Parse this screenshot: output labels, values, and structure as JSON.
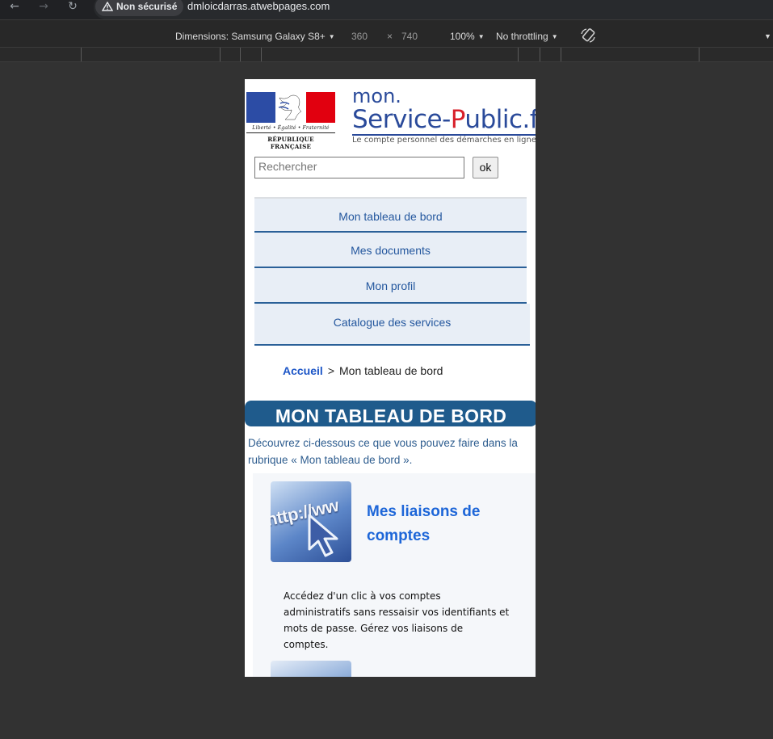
{
  "browser": {
    "security_label": "Non sécurisé",
    "url": "dmloicdarras.atwebpages.com",
    "icons": [
      "back-icon",
      "forward-icon",
      "reload-icon",
      "warning-icon"
    ]
  },
  "devtools": {
    "dimensions_label": "Dimensions: Samsung Galaxy S8+",
    "width": "360",
    "times": "×",
    "height": "740",
    "zoom": "100%",
    "throttling": "No throttling"
  },
  "header": {
    "motto": "Liberté • Égalité • Fraternité",
    "republic": "RÉPUBLIQUE FRANÇAISE",
    "brand_mon": "mon.",
    "brand_service": "Service-",
    "brand_p": "P",
    "brand_rest": "ublic.fr",
    "tagline": "Le compte personnel des démarches en ligne"
  },
  "search": {
    "placeholder": "Rechercher",
    "button": "ok"
  },
  "menu": {
    "items": [
      {
        "label": "Mon tableau de bord"
      },
      {
        "label": "Mes documents"
      },
      {
        "label": "Mon profil"
      },
      {
        "label": "Catalogue des services"
      }
    ]
  },
  "breadcrumb": {
    "home": "Accueil",
    "separator": ">",
    "current": "Mon tableau de bord"
  },
  "page": {
    "title": "MON TABLEAU DE BORD",
    "intro": "Découvrez ci-dessous ce que vous pouvez faire dans la rubrique « Mon tableau de bord »."
  },
  "card": {
    "thumb_text": "http://ww",
    "title": "Mes liaisons de comptes",
    "description": "Accédez d'un clic à vos comptes administratifs sans ressaisir vos identifiants et mots de passe. Gérez vos liaisons de comptes."
  },
  "colors": {
    "menu_bg": "#e8eef6",
    "menu_text": "#24579e",
    "banner_bg": "#1f5b8c",
    "link": "#1d66d8"
  }
}
